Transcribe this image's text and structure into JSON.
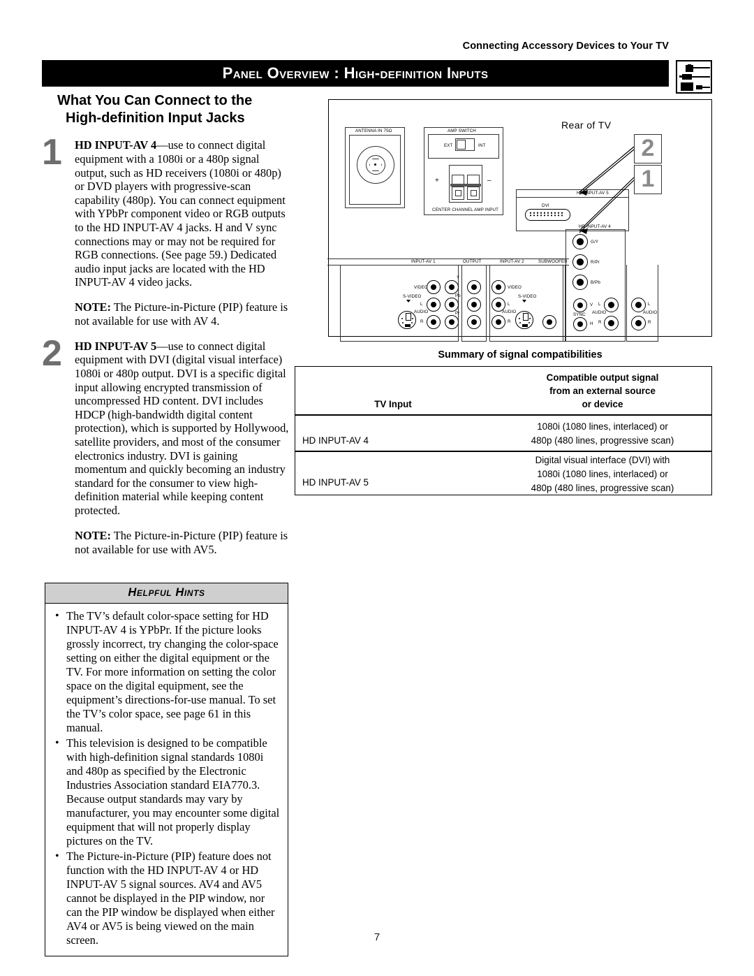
{
  "running_head": "Connecting Accessory Devices to Your TV",
  "title": "Panel Overview : High-definition Inputs",
  "title_icon": "av-cable-connectors-icon",
  "section_heading": {
    "line1": "What You Can Connect to the",
    "line2": "High-definition Input Jacks"
  },
  "items": [
    {
      "number": "1",
      "lead": "HD INPUT-AV 4",
      "text": "—use to connect digital equipment with a 1080i or a 480p signal output, such as HD receivers (1080i or 480p) or DVD players with progressive-scan capability (480p). You can connect equipment with YPbPr component video or RGB outputs to the HD INPUT-AV 4 jacks. H and V sync connections may or may not be required for RGB connections. (See page 59.) Dedicated audio input jacks are located with the HD INPUT-AV 4 video jacks.",
      "note_label": "NOTE:",
      "note_text": " The Picture-in-Picture (PIP) feature is not available for use with AV 4."
    },
    {
      "number": "2",
      "lead": "HD INPUT-AV 5",
      "text": "—use to connect digital equipment with DVI (digital visual interface) 1080i or 480p output. DVI is a specific digital input allowing encrypted transmission of uncompressed HD content. DVI includes HDCP (high-bandwidth digital content protection), which is supported by Hollywood, satellite providers, and most of the consumer electronics industry. DVI is gaining momentum and quickly becoming an industry standard for the consumer to view high-definition material while keeping content protected.",
      "note_label": "NOTE:",
      "note_text": " The Picture-in-Picture (PIP) feature is not available for use with AV5."
    }
  ],
  "helpful_hints": {
    "title": "Helpful Hints",
    "bullet_glyph": "•",
    "hints": [
      "The TV’s default color-space setting for HD INPUT-AV 4 is YPbPr. If the picture looks grossly incorrect, try changing the color-space setting on either the digital equipment or the TV. For more information on setting the color space on the digital equipment, see the equipment’s directions-for-use manual. To set the TV’s color space, see page 61 in this manual.",
      "This television is designed to be compatible with high-definition signal standards 1080i and 480p as specified by the Electronic Industries Association standard EIA770.3. Because output standards may vary by manufacturer, you may encounter some digital equipment that will not properly display pictures on the TV.",
      "The Picture-in-Picture (PIP) feature does not function with the HD INPUT-AV 4 or HD INPUT-AV 5 signal sources. AV4 and AV5 cannot be displayed in the PIP window, nor can the PIP window be displayed when either AV4 or AV5 is being viewed on the main screen."
    ]
  },
  "diagram": {
    "rear_label": "Rear of TV",
    "antenna_label": "ANTENNA IN 75Ω",
    "amp_switch_label": "AMP SWITCH",
    "amp_ext": "EXT",
    "amp_int": "INT",
    "amp_plus": "+",
    "amp_minus": "–",
    "center_channel_label": "CENTER CHANNEL AMP INPUT",
    "hd_av5_label": "HD INPUT-AV 5",
    "dvi_label": "DVI",
    "hd_av4_label": "HD INPUT-AV 4",
    "panel_labels": [
      "INPUT-AV 1",
      "OUTPUT",
      "INPUT-AV 2",
      "SUBWOOFER"
    ],
    "jack_labels": {
      "video": "VIDEO",
      "s_video": "S-VIDEO",
      "audio": "AUDIO",
      "left": "L",
      "right": "R",
      "y": "Y",
      "pb": "Pb",
      "pr": "Pr",
      "gy": "G/Y",
      "rpr": "R/Pr",
      "bpb": "B/Pb",
      "v": "V",
      "h": "H",
      "sync": "SYNC"
    },
    "callouts": [
      "2",
      "1"
    ]
  },
  "table": {
    "title": "Summary of signal compatibilities",
    "headers": {
      "col1": "TV Input",
      "col2_line1": "Compatible output signal",
      "col2_line2": "from an external source",
      "col2_line3": "or device"
    },
    "rows": [
      {
        "input": "HD INPUT-AV 4",
        "signal_lines": [
          "1080i (1080 lines, interlaced) or",
          "480p (480 lines, progressive scan)"
        ]
      },
      {
        "input": "HD INPUT-AV 5",
        "signal_lines": [
          "Digital visual interface (DVI) with",
          "1080i (1080 lines, interlaced) or",
          "480p (480 lines, progressive scan)"
        ]
      }
    ]
  },
  "page_number": "7",
  "colors": {
    "title_bar": "#000000",
    "callout_number": "#8a8a8a",
    "item_number": "#6e6e6e",
    "hints_header_bg": "#cfcfcf"
  }
}
